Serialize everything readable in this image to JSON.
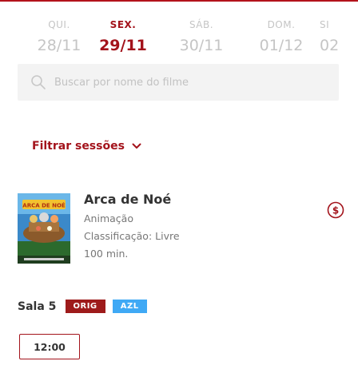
{
  "colors": {
    "accent": "#a3131b",
    "inactive_date": "#c5c5c5",
    "badge_orig": "#9e1b1b",
    "badge_azl": "#3fa9f5"
  },
  "dates": [
    {
      "dow": "QUI.",
      "date": "28/11",
      "active": false
    },
    {
      "dow": "SEX.",
      "date": "29/11",
      "active": true
    },
    {
      "dow": "SÁB.",
      "date": "30/11",
      "active": false
    },
    {
      "dow": "DOM.",
      "date": "01/12",
      "active": false
    },
    {
      "dow": "SI",
      "date": "02",
      "active": false
    }
  ],
  "search": {
    "placeholder": "Buscar por nome do filme",
    "value": "",
    "icon": "search-icon"
  },
  "filter": {
    "label": "Filtrar sessões",
    "icon": "chevron-down-icon"
  },
  "movie": {
    "title": "Arca de Noé",
    "genre": "Animação",
    "rating": "Classificação: Livre",
    "duration": "100 min.",
    "poster_icon": "movie-poster",
    "poster_title": "ARCA DE NOÉ",
    "price_icon": "dollar-circle-icon"
  },
  "room": {
    "label": "Sala 5",
    "badges": [
      "ORIG",
      "AZL"
    ]
  },
  "sessions": [
    "12:00"
  ]
}
